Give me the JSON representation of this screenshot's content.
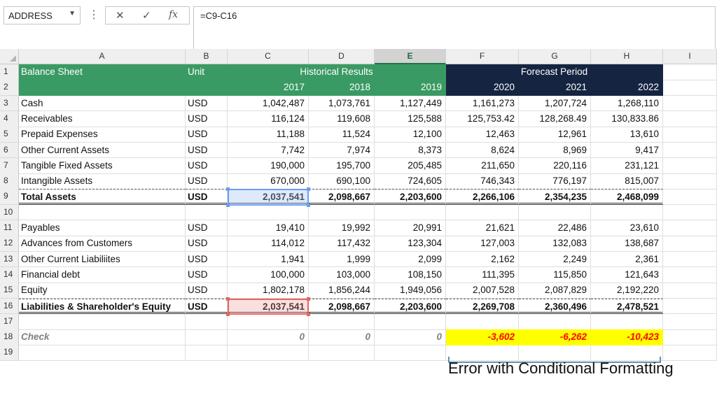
{
  "formula_bar": {
    "name_box": "ADDRESS",
    "dropdown_icon": "chevron-down-icon",
    "cancel_icon": "✕",
    "enter_icon": "✓",
    "fx_label": "fx",
    "formula": "=C9-C16"
  },
  "columns": [
    "A",
    "B",
    "C",
    "D",
    "E",
    "F",
    "G",
    "H",
    "I"
  ],
  "rows": [
    "1",
    "2",
    "3",
    "4",
    "5",
    "6",
    "7",
    "8",
    "9",
    "10",
    "11",
    "12",
    "13",
    "14",
    "15",
    "16",
    "17",
    "18",
    "19"
  ],
  "header": {
    "balance_sheet": "Balance Sheet",
    "unit": "Unit",
    "historical": "Historical Results",
    "forecast": "Forecast Period",
    "years": [
      "2017",
      "2018",
      "2019",
      "2020",
      "2021",
      "2022"
    ]
  },
  "assets": [
    {
      "label": "Cash",
      "unit": "USD",
      "values": [
        "1,042,487",
        "1,073,761",
        "1,127,449",
        "1,161,273",
        "1,207,724",
        "1,268,110"
      ]
    },
    {
      "label": "Receivables",
      "unit": "USD",
      "values": [
        "116,124",
        "119,608",
        "125,588",
        "125,753.42",
        "128,268.49",
        "130,833.86"
      ]
    },
    {
      "label": "Prepaid Expenses",
      "unit": "USD",
      "values": [
        "11,188",
        "11,524",
        "12,100",
        "12,463",
        "12,961",
        "13,610"
      ]
    },
    {
      "label": "Other Current Assets",
      "unit": "USD",
      "values": [
        "7,742",
        "7,974",
        "8,373",
        "8,624",
        "8,969",
        "9,417"
      ]
    },
    {
      "label": "Tangible Fixed Assets",
      "unit": "USD",
      "values": [
        "190,000",
        "195,700",
        "205,485",
        "211,650",
        "220,116",
        "231,121"
      ]
    },
    {
      "label": "Intangible Assets",
      "unit": "USD",
      "values": [
        "670,000",
        "690,100",
        "724,605",
        "746,343",
        "776,197",
        "815,007"
      ]
    }
  ],
  "total_assets": {
    "label": "Total Assets",
    "unit": "USD",
    "values": [
      "2,037,541",
      "2,098,667",
      "2,203,600",
      "2,266,106",
      "2,354,235",
      "2,468,099"
    ]
  },
  "liabilities": [
    {
      "label": "Payables",
      "unit": "USD",
      "values": [
        "19,410",
        "19,992",
        "20,991",
        "21,621",
        "22,486",
        "23,610"
      ]
    },
    {
      "label": "Advances from Customers",
      "unit": "USD",
      "values": [
        "114,012",
        "117,432",
        "123,304",
        "127,003",
        "132,083",
        "138,687"
      ]
    },
    {
      "label": "Other Current Liabiliites",
      "unit": "USD",
      "values": [
        "1,941",
        "1,999",
        "2,099",
        "2,162",
        "2,249",
        "2,361"
      ]
    },
    {
      "label": "Financial debt",
      "unit": "USD",
      "values": [
        "100,000",
        "103,000",
        "108,150",
        "111,395",
        "115,850",
        "121,643"
      ]
    },
    {
      "label": "Equity",
      "unit": "USD",
      "values": [
        "1,802,178",
        "1,856,244",
        "1,949,056",
        "2,007,528",
        "2,087,829",
        "2,192,220"
      ]
    }
  ],
  "total_liabilities": {
    "label": "Liabilities & Shareholder's Equity",
    "unit": "USD",
    "values": [
      "2,037,541",
      "2,098,667",
      "2,203,600",
      "2,269,708",
      "2,360,496",
      "2,478,521"
    ]
  },
  "check": {
    "label": "Check",
    "values": [
      "0",
      "0",
      "0",
      "-3,602",
      "-6,262",
      "-10,423"
    ]
  },
  "annotation": "Error with Conditional Formatting",
  "colors": {
    "header_green": "#3a9a63",
    "header_navy": "#152440",
    "highlight_yellow": "#ffff00",
    "error_red": "#ff0000"
  }
}
